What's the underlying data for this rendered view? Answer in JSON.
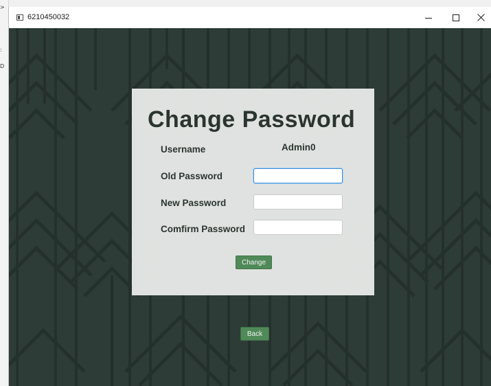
{
  "left_strip": {
    "glyphs": [
      ">",
      ":",
      "D"
    ]
  },
  "window": {
    "title": "6210450032",
    "controls": {
      "minimize_icon": "minimize-icon",
      "maximize_icon": "maximize-icon",
      "close_icon": "close-icon"
    }
  },
  "form": {
    "title": "Change Password",
    "username_label": "Username",
    "username_value": "Admin0",
    "old_password_label": "Old Password",
    "old_password_value": "",
    "new_password_label": "New Password",
    "new_password_value": "",
    "confirm_password_label": "Comfirm Password",
    "confirm_password_value": "",
    "change_label": "Change"
  },
  "back_label": "Back",
  "colors": {
    "background": "#2e3d38",
    "pattern_line": "#1f2a26",
    "panel": "#e8e9e8",
    "button": "#4f8a58",
    "focus_border": "#3b8fd8"
  }
}
